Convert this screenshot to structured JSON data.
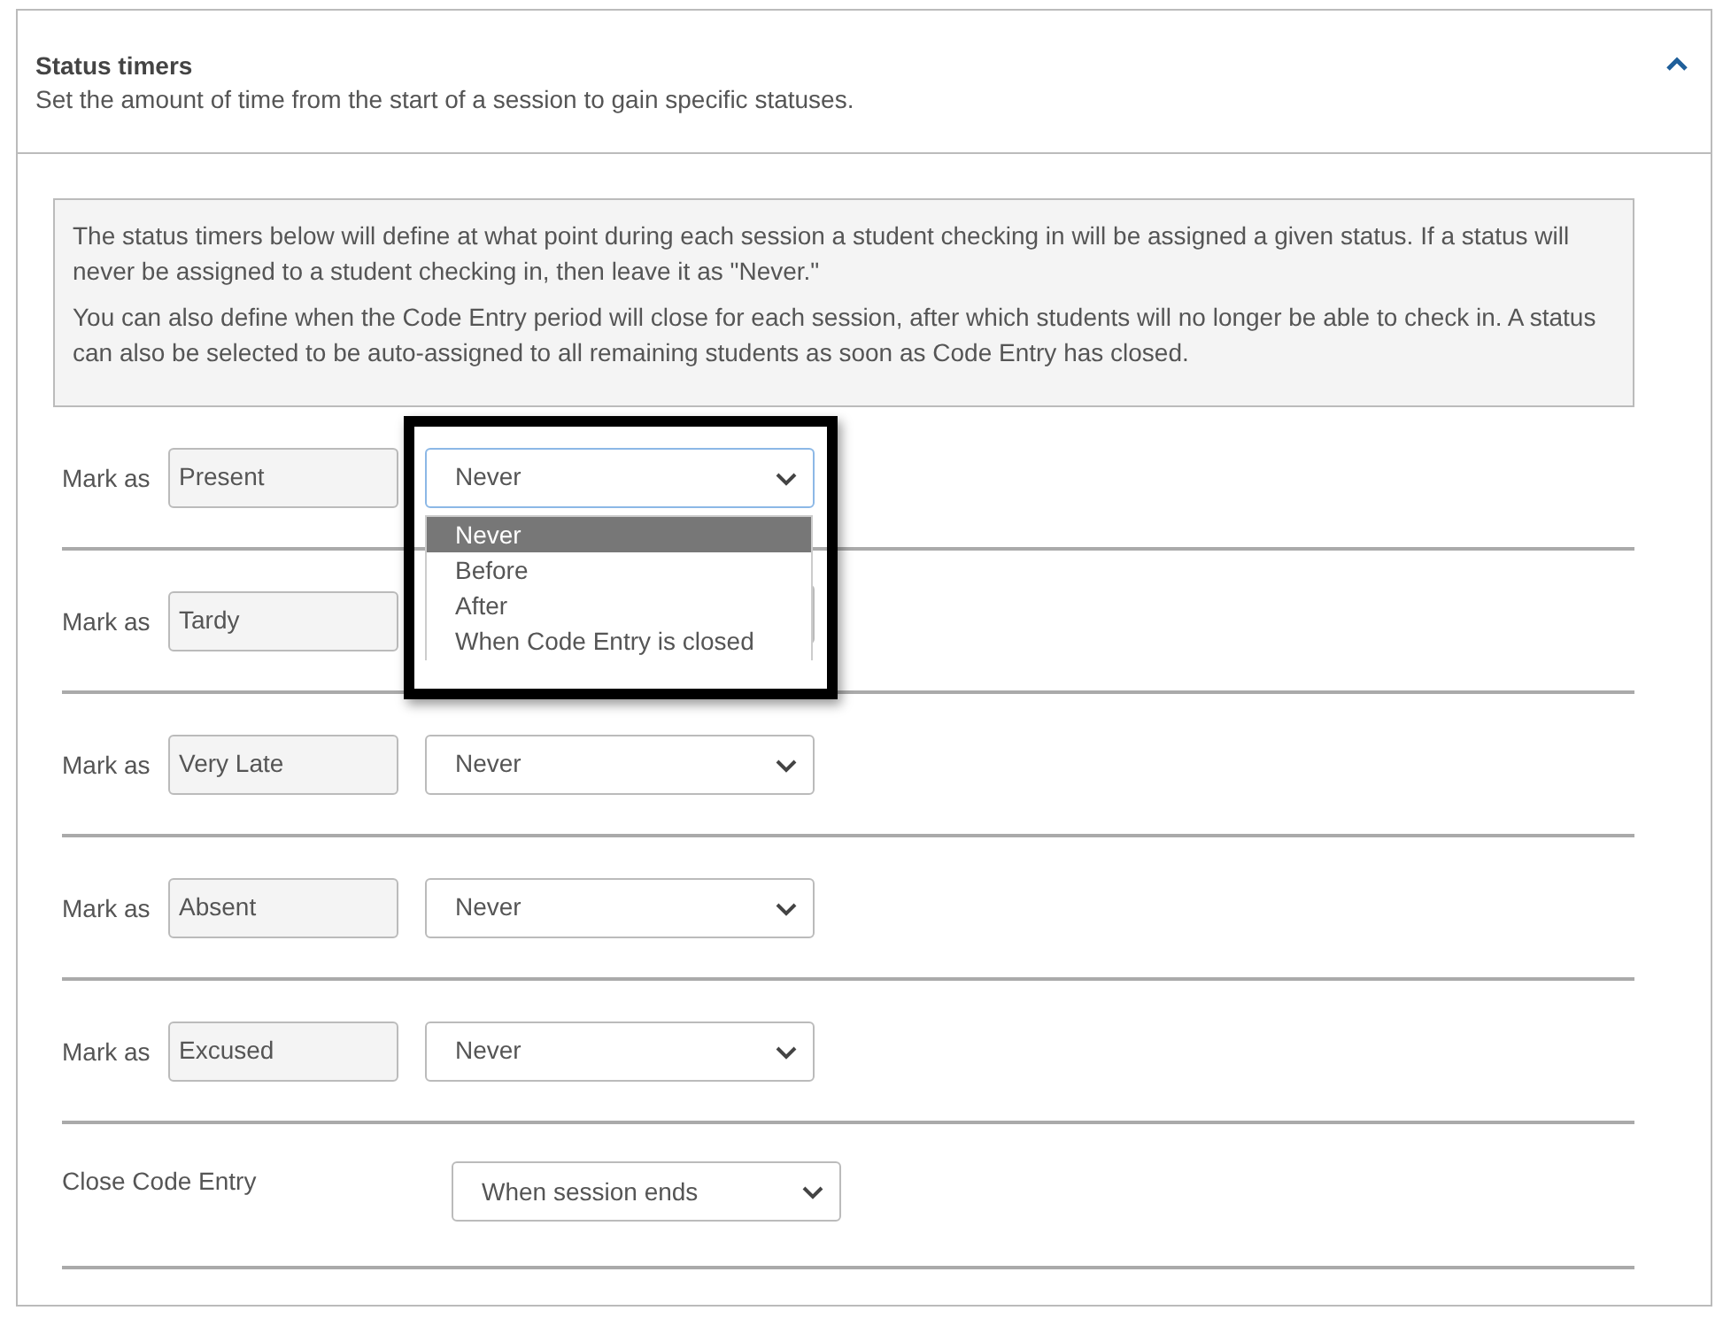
{
  "panel": {
    "title": "Status timers",
    "subtitle": "Set the amount of time from the start of a session to gain specific statuses.",
    "expanded": true
  },
  "info": [
    "The status timers below will define at what point during each session a student checking in will be assigned a given status. If a status will never be assigned to a student checking in, then leave it as \"Never.\"",
    "You can also define when the Code Entry period will close for each session, after which students will no longer be able to check in. A status can also be selected to be auto-assigned to all remaining students as soon as Code Entry has closed."
  ],
  "rows": [
    {
      "kind": "status",
      "label": "Mark as",
      "status": "Present",
      "select": {
        "value": "Never",
        "open": true,
        "options": [
          {
            "label": "Never",
            "selected": true
          },
          {
            "label": "Before",
            "selected": false
          },
          {
            "label": "After",
            "selected": false
          },
          {
            "label": "When Code Entry is closed",
            "selected": false
          }
        ]
      }
    },
    {
      "kind": "status",
      "label": "Mark as",
      "status": "Tardy",
      "select": {
        "open": false
      }
    },
    {
      "kind": "status",
      "label": "Mark as",
      "status": "Very Late",
      "select": {
        "value": "Never",
        "open": false
      }
    },
    {
      "kind": "status",
      "label": "Mark as",
      "status": "Absent",
      "select": {
        "value": "Never",
        "open": false
      }
    },
    {
      "kind": "status",
      "label": "Mark as",
      "status": "Excused",
      "select": {
        "value": "Never",
        "open": false
      }
    },
    {
      "kind": "close",
      "label": "Close Code Entry",
      "select": {
        "value": "When session ends",
        "open": false
      }
    }
  ]
}
